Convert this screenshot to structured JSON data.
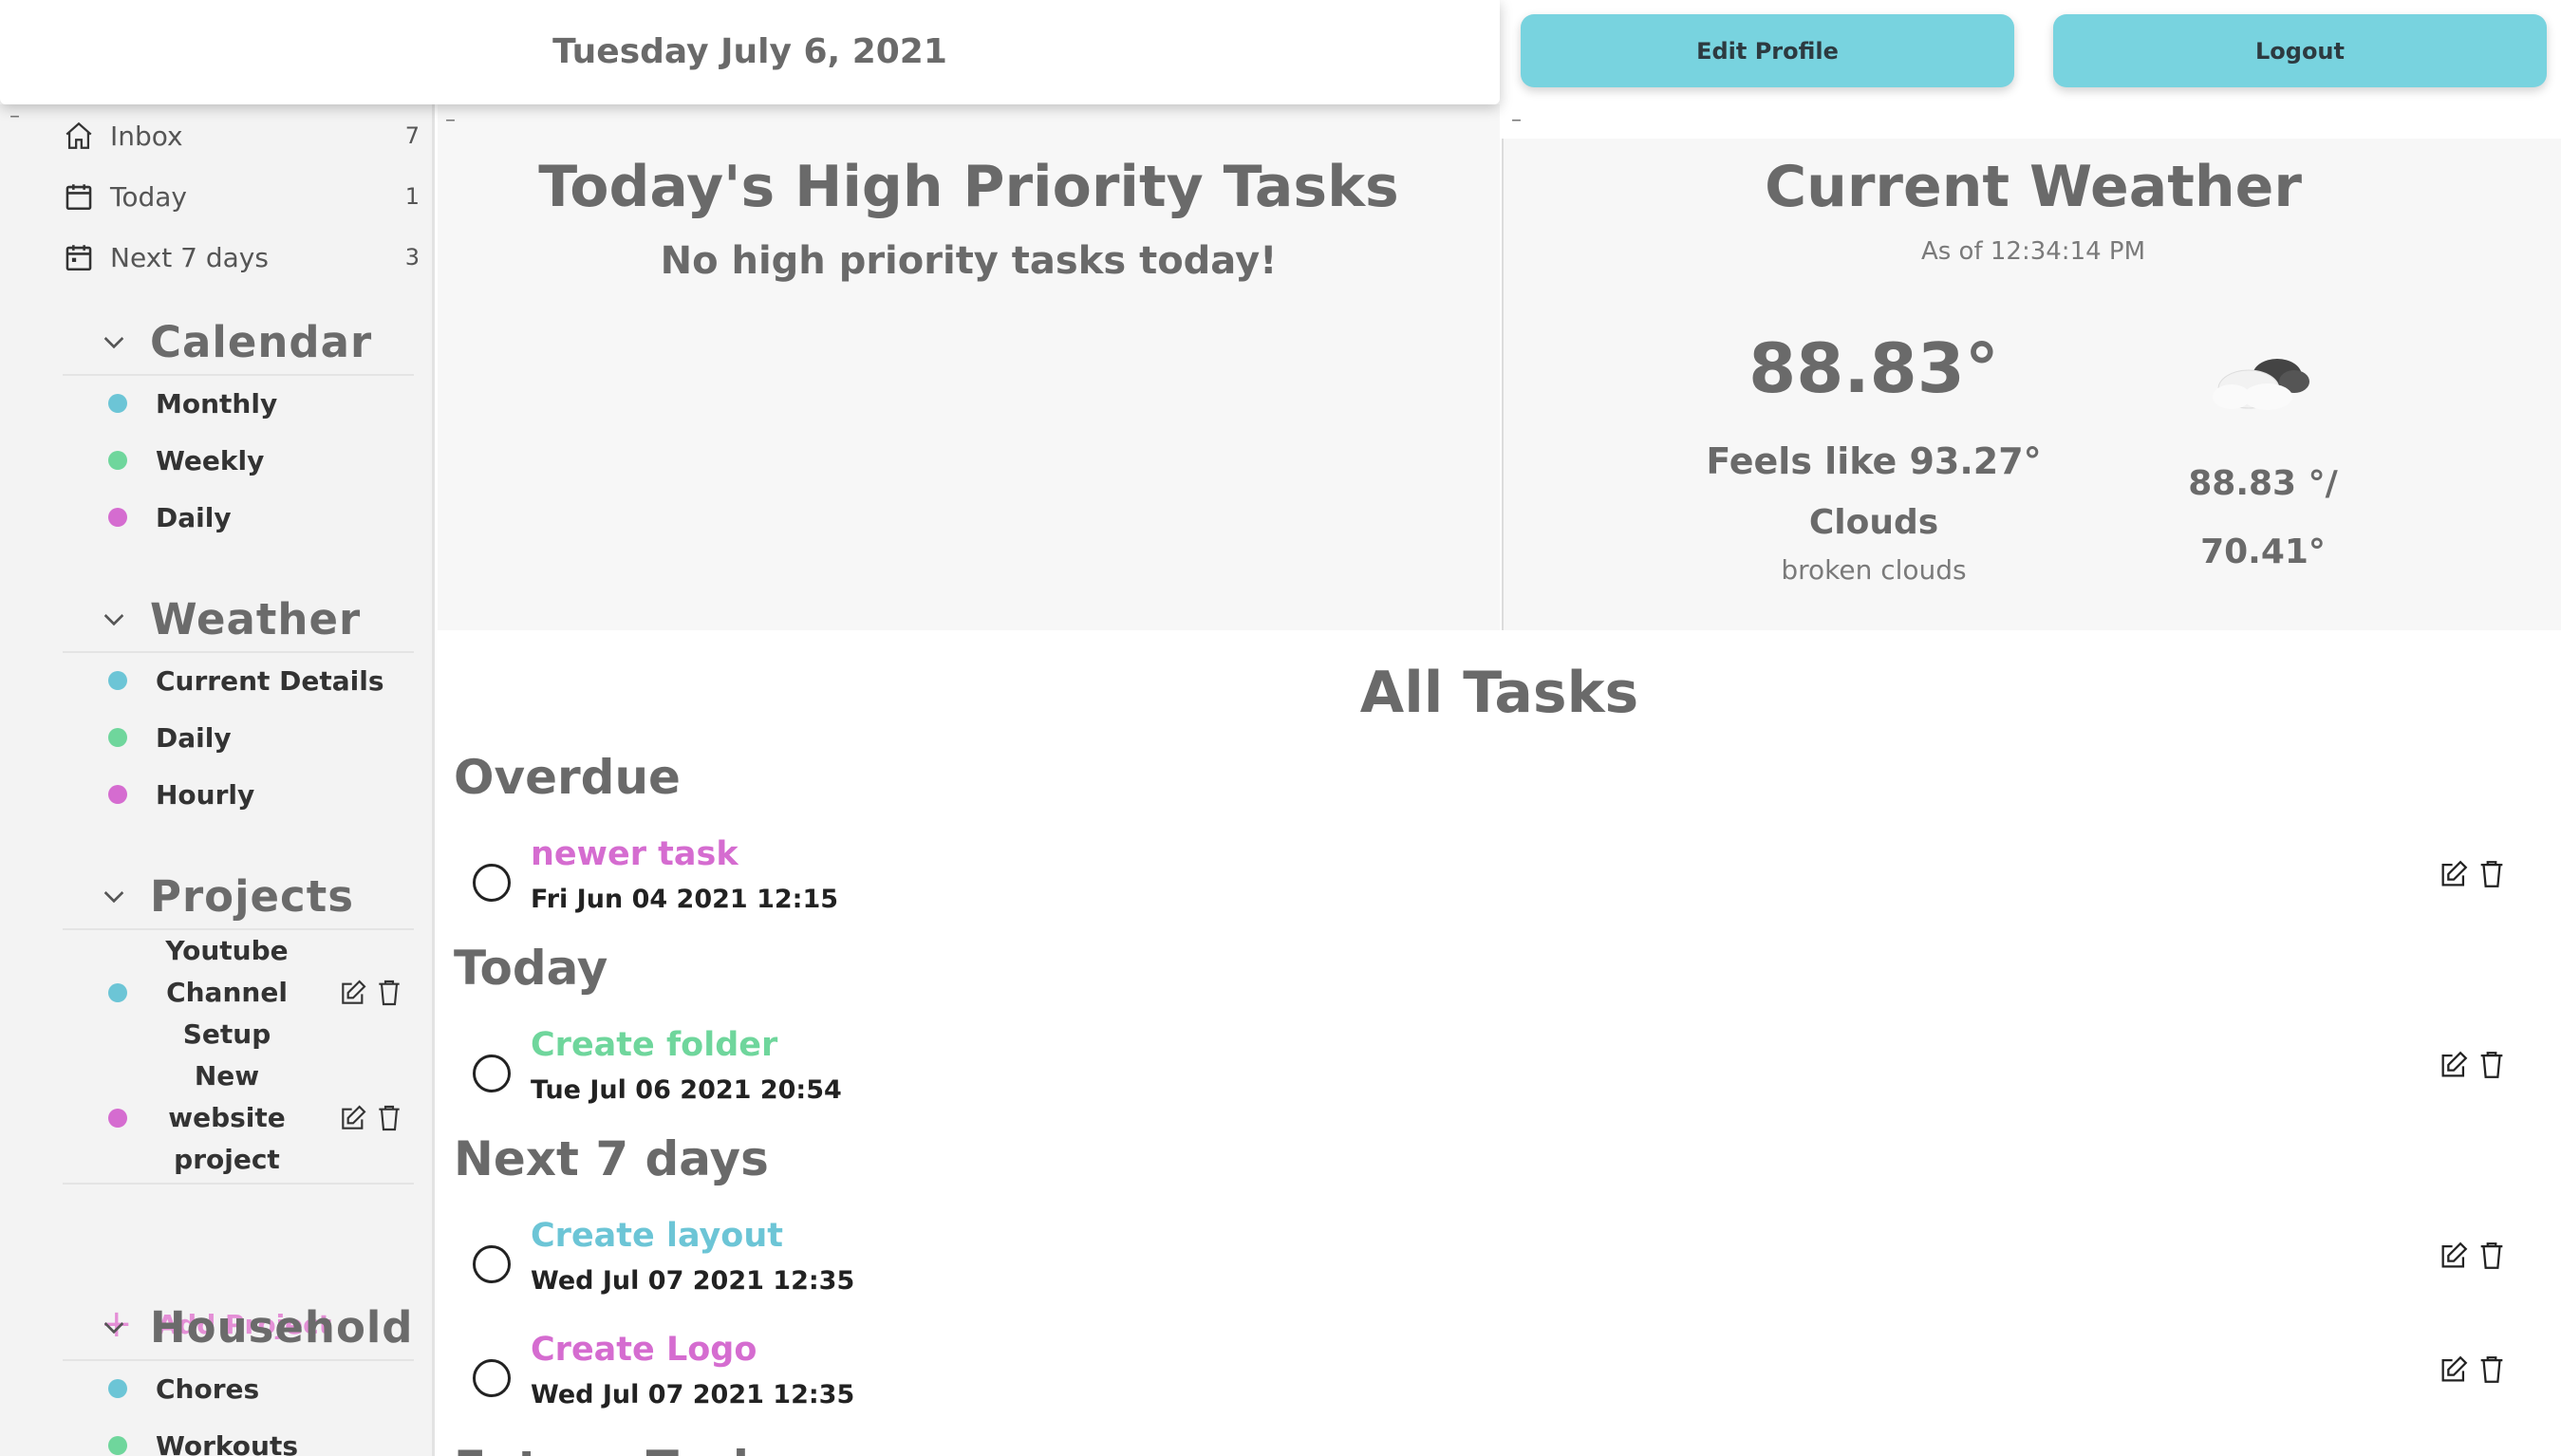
{
  "header": {
    "date": "Tuesday July 6, 2021",
    "edit_profile_label": "Edit Profile",
    "logout_label": "Logout"
  },
  "sidebar": {
    "nav": [
      {
        "label": "Inbox",
        "count": "7",
        "icon": "home-icon"
      },
      {
        "label": "Today",
        "count": "1",
        "icon": "calendar-icon"
      },
      {
        "label": "Next 7 days",
        "count": "3",
        "icon": "calendar-icon"
      }
    ],
    "groups": [
      {
        "title": "Calendar",
        "items": [
          {
            "label": "Monthly",
            "color": "#6cc5d6"
          },
          {
            "label": "Weekly",
            "color": "#6fd69c"
          },
          {
            "label": "Daily",
            "color": "#d56cd0"
          }
        ]
      },
      {
        "title": "Weather",
        "items": [
          {
            "label": "Current Details",
            "color": "#6cc5d6"
          },
          {
            "label": "Daily",
            "color": "#6fd69c"
          },
          {
            "label": "Hourly",
            "color": "#d56cd0"
          }
        ]
      },
      {
        "title": "Projects",
        "items": [
          {
            "label": "Youtube\nChannel\nSetup",
            "color": "#6cc5d6"
          },
          {
            "label": "New\nwebsite\nproject",
            "color": "#d56cd0"
          }
        ],
        "add_label": "Add Project"
      },
      {
        "title": "Household",
        "items": [
          {
            "label": "Chores",
            "color": "#6cc5d6"
          },
          {
            "label": "Workouts",
            "color": "#6fd69c"
          }
        ]
      }
    ]
  },
  "priority": {
    "title": "Today's High Priority Tasks",
    "empty_message": "No high priority tasks today!"
  },
  "weather": {
    "title": "Current Weather",
    "as_of": "As of 12:34:14 PM",
    "temp": "88.83°",
    "feels_like": "Feels like 93.27°",
    "condition": "Clouds",
    "description": "broken clouds",
    "high_low_1": "88.83 °/",
    "high_low_2": "70.41°",
    "icon": "cloud-icon"
  },
  "tasks": {
    "title": "All Tasks",
    "sections": [
      {
        "title": "Overdue",
        "items": [
          {
            "name": "newer task",
            "date": "Fri Jun 04 2021 12:15",
            "color": "#d56cd0"
          }
        ]
      },
      {
        "title": "Today",
        "items": [
          {
            "name": "Create folder",
            "date": "Tue Jul 06 2021 20:54",
            "color": "#6fd69c"
          }
        ]
      },
      {
        "title": "Next 7 days",
        "items": [
          {
            "name": "Create layout",
            "date": "Wed Jul 07 2021 12:35",
            "color": "#6cc5d6"
          },
          {
            "name": "Create Logo",
            "date": "Wed Jul 07 2021 12:35",
            "color": "#d56cd0"
          }
        ]
      }
    ],
    "next_section_partial": "Future Tasks"
  }
}
